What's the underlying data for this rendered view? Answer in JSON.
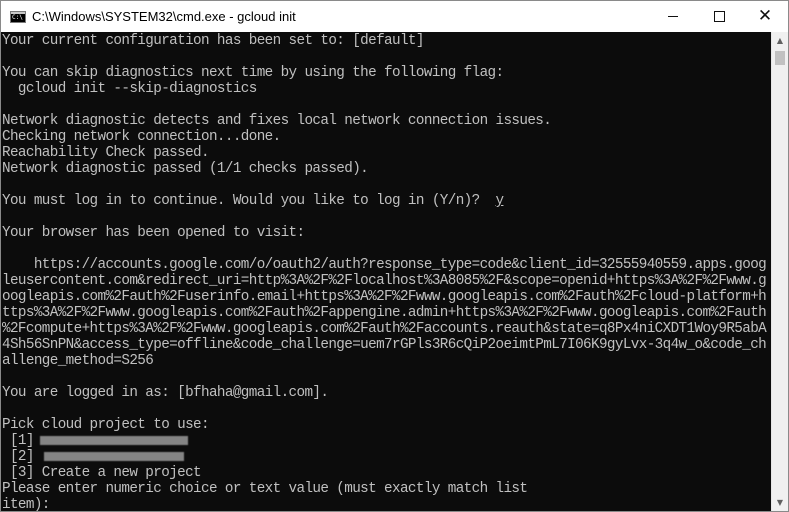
{
  "window": {
    "title": "C:\\Windows\\SYSTEM32\\cmd.exe - gcloud  init",
    "app_icon": "cmd-icon",
    "controls": {
      "minimize": "minimize-icon",
      "maximize": "maximize-icon",
      "close": "close-icon",
      "close_glyph": "✕"
    }
  },
  "console": {
    "text_color": "#c0c0c0",
    "background": "#0c0c0c",
    "lines": [
      "Your current configuration has been set to: [default]",
      "",
      "You can skip diagnostics next time by using the following flag:",
      "  gcloud init --skip-diagnostics",
      "",
      "Network diagnostic detects and fixes local network connection issues.",
      "Checking network connection...done.",
      "Reachability Check passed.",
      "Network diagnostic passed (1/1 checks passed).",
      "",
      "You must log in to continue. Would you like to log in (Y/n)?  ",
      "",
      "Your browser has been opened to visit:",
      "",
      "    https://accounts.google.com/o/oauth2/auth?response_type=code&client_id=32555940559.apps.goog",
      "leusercontent.com&redirect_uri=http%3A%2F%2Flocalhost%3A8085%2F&scope=openid+https%3A%2F%2Fwww.g",
      "oogleapis.com%2Fauth%2Fuserinfo.email+https%3A%2F%2Fwww.googleapis.com%2Fauth%2Fcloud-platform+h",
      "ttps%3A%2F%2Fwww.googleapis.com%2Fauth%2Fappengine.admin+https%3A%2F%2Fwww.googleapis.com%2Fauth",
      "%2Fcompute+https%3A%2F%2Fwww.googleapis.com%2Fauth%2Faccounts.reauth&state=q8Px4niCXDT1Woy9R5abA",
      "4Sh56SnPN&access_type=offline&code_challenge=uem7rGPls3R6cQiP2oeimtPmL7I06K9gyLvx-3q4w_o&code_ch",
      "allenge_method=S256",
      "",
      "You are logged in as: [bfhaha@gmail.com].",
      "",
      "Pick cloud project to use:",
      " [1]",
      " [2]",
      " [3] Create a new project",
      "Please enter numeric choice or text value (must exactly match list",
      "item):"
    ],
    "login_answer": "y"
  },
  "scrollbar": {
    "up_arrow": "▲",
    "down_arrow": "▼"
  }
}
